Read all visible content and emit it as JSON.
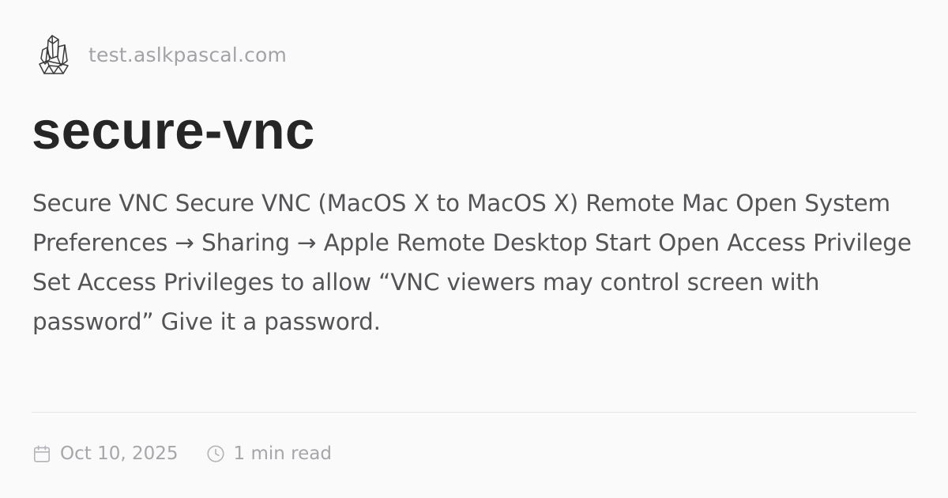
{
  "site": {
    "name": "test.aslkpascal.com",
    "logo_icon": "crystal-logo-icon"
  },
  "post": {
    "title": "secure-vnc",
    "summary": "Secure VNC Secure VNC (MacOS X to MacOS X) Remote Mac Open System Preferences → Sharing → Apple Remote Desktop Start Open Access Privilege Set Access Privileges to allow “VNC viewers may control screen with password” Give it a password."
  },
  "meta": {
    "date": "Oct 10, 2025",
    "date_icon": "calendar-icon",
    "read_time": "1 min read",
    "read_time_icon": "clock-icon"
  },
  "colors": {
    "background": "#fbfafb",
    "title": "#262626",
    "body_text": "#545457",
    "muted": "#a6a6aa",
    "divider": "#e6e5e8"
  }
}
